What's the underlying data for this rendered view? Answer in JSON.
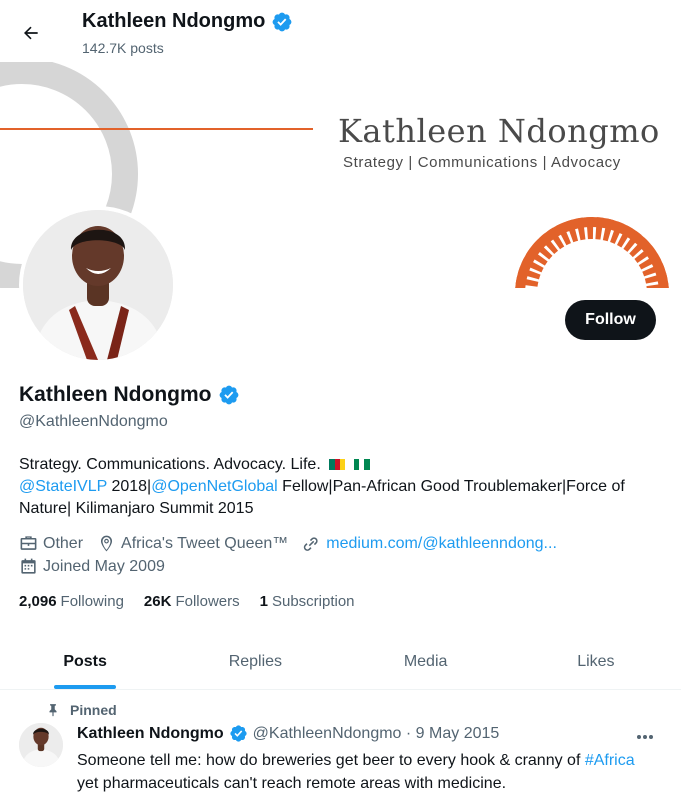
{
  "header": {
    "back_icon": "arrow-left-icon",
    "name": "Kathleen Ndongmo",
    "posts_count": "142.7K posts"
  },
  "banner": {
    "title": "Kathleen Ndongmo",
    "subtitle": "Strategy | Communications | Advocacy",
    "accent_color": "#e2622a"
  },
  "profile": {
    "display_name": "Kathleen Ndongmo",
    "handle": "@KathleenNdongmo",
    "verified": true,
    "follow_label": "Follow",
    "bio_line1": "Strategy. Communications. Advocacy. Life.",
    "bio_mention1": "@StateIVLP",
    "bio_text2": " 2018|",
    "bio_mention2": "@OpenNetGlobal",
    "bio_text3": " Fellow|Pan-African Good Troublemaker|Force of Nature| Kilimanjaro Summit 2015",
    "category": "Other",
    "location": "Africa's Tweet Queen™",
    "website": "medium.com/@kathleenndong...",
    "joined": "Joined May 2009"
  },
  "stats": {
    "following_count": "2,096",
    "following_label": "Following",
    "followers_count": "26K",
    "followers_label": "Followers",
    "subscription_count": "1",
    "subscription_label": "Subscription"
  },
  "tabs": [
    {
      "label": "Posts",
      "active": true
    },
    {
      "label": "Replies",
      "active": false
    },
    {
      "label": "Media",
      "active": false
    },
    {
      "label": "Likes",
      "active": false
    }
  ],
  "pinned_post": {
    "pinned_label": "Pinned",
    "author": "Kathleen Ndongmo",
    "handle_date": "@KathleenNdongmo · 9 May 2015",
    "text_part1": "Someone tell me: how do breweries get beer to every hook & cranny of ",
    "hashtag": "#Africa",
    "text_part2": " yet pharmaceuticals can't reach remote areas with medicine."
  },
  "colors": {
    "verified_blue": "#1d9bf0",
    "link_blue": "#1d9bf0",
    "text_primary": "#0f1419",
    "text_secondary": "#536471",
    "follow_button_bg": "#0f1419"
  }
}
